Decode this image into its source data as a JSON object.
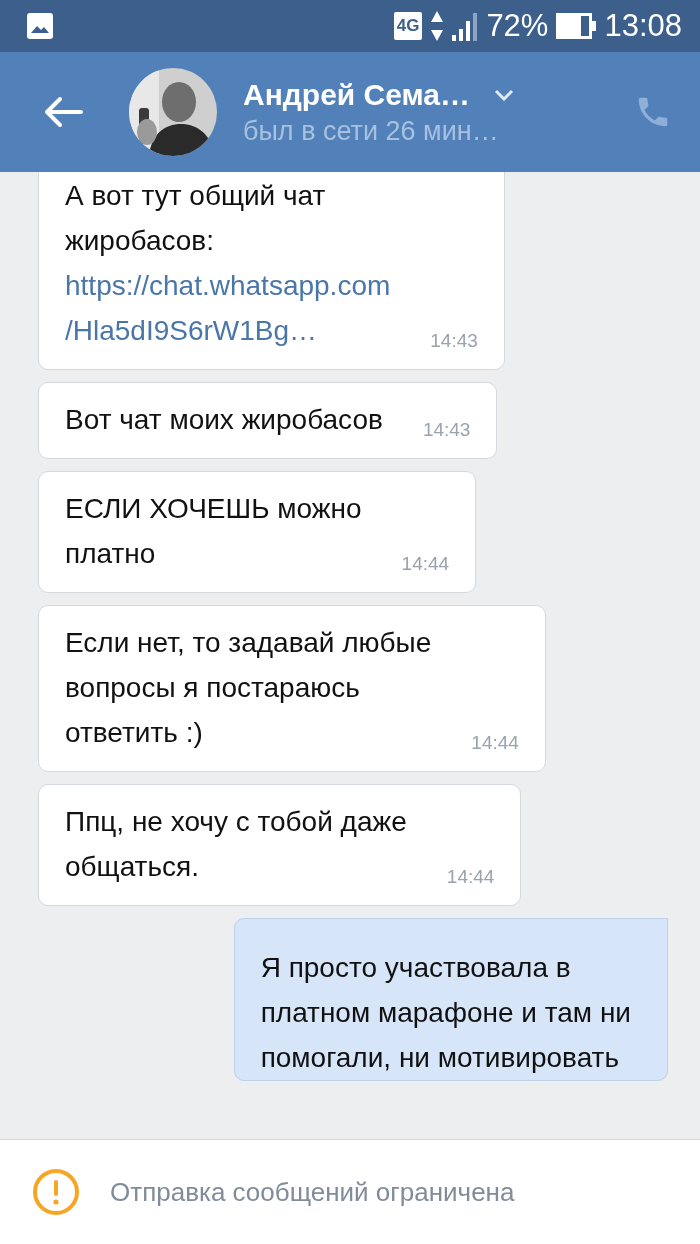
{
  "status_bar": {
    "network": "4G",
    "battery": "72%",
    "time": "13:08"
  },
  "header": {
    "name": "Андрей Сема…",
    "status": "был в сети 26 мин…"
  },
  "messages": [
    {
      "kind": "incoming",
      "lines": [
        "А вот тут общий чат",
        "жиробасов:"
      ],
      "link_lines": [
        "https://chat.whatsapp.com",
        "/Hla5dI9S6rW1Bg…"
      ],
      "time": "14:43"
    },
    {
      "kind": "incoming",
      "lines": [
        "Вот чат моих жиробасов"
      ],
      "time": "14:43"
    },
    {
      "kind": "incoming",
      "lines": [
        "ЕСЛИ ХОЧЕШЬ можно",
        "платно"
      ],
      "time": "14:44"
    },
    {
      "kind": "incoming",
      "lines": [
        "Если нет, то задавай любые",
        "вопросы я постараюсь",
        "ответить :)"
      ],
      "time": "14:44"
    },
    {
      "kind": "incoming",
      "lines": [
        "Ппц, не хочу с тобой даже",
        "общаться."
      ],
      "time": "14:44"
    },
    {
      "kind": "outgoing",
      "lines": [
        "Я просто участвовала в",
        "платном марафоне и там ни",
        "помогали, ни мотивировать"
      ]
    }
  ],
  "notice": {
    "text": "Отправка сообщений ограничена"
  }
}
